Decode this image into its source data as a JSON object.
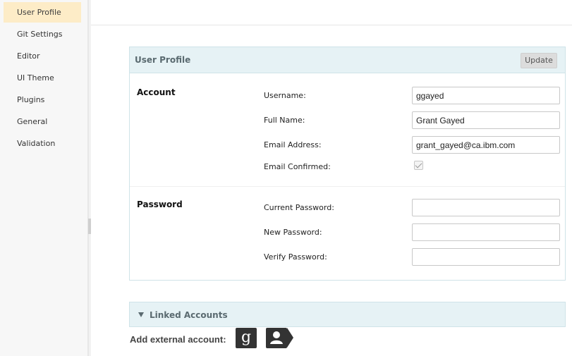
{
  "sidebar": {
    "items": [
      {
        "label": "User Profile",
        "active": true
      },
      {
        "label": "Git Settings",
        "active": false
      },
      {
        "label": "Editor",
        "active": false
      },
      {
        "label": "UI Theme",
        "active": false
      },
      {
        "label": "Plugins",
        "active": false
      },
      {
        "label": "General",
        "active": false
      },
      {
        "label": "Validation",
        "active": false
      }
    ]
  },
  "profile": {
    "title": "User Profile",
    "update_label": "Update",
    "account": {
      "heading": "Account",
      "username_label": "Username:",
      "username_value": "ggayed",
      "fullname_label": "Full Name:",
      "fullname_value": "Grant Gayed",
      "email_label": "Email Address:",
      "email_value": "grant_gayed@ca.ibm.com",
      "email_confirmed_label": "Email Confirmed:",
      "email_confirmed": true
    },
    "password": {
      "heading": "Password",
      "current_label": "Current Password:",
      "new_label": "New Password:",
      "verify_label": "Verify Password:"
    }
  },
  "linked": {
    "title": "Linked Accounts",
    "add_label": "Add external account:",
    "providers": [
      "google-icon",
      "persona-icon"
    ]
  }
}
